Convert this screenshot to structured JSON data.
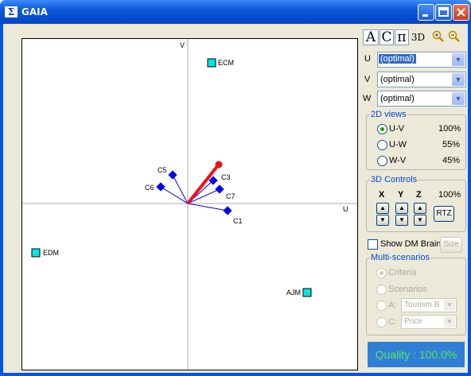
{
  "window": {
    "title": "GAIA",
    "app_icon": "sigma-icon"
  },
  "plot": {
    "axis_v_label": "V",
    "axis_u_label": "U",
    "alternatives": [
      {
        "label": "ECM"
      },
      {
        "label": "EDM"
      },
      {
        "label": "AJM"
      }
    ],
    "criteria": [
      {
        "label": "C5"
      },
      {
        "label": "C6"
      },
      {
        "label": "C3"
      },
      {
        "label": "C7"
      },
      {
        "label": "C1"
      }
    ],
    "colors": {
      "criteria": "#0000ee",
      "alternatives": "#00e5e5",
      "decision_stick": "#ee1111"
    }
  },
  "toolbar": {
    "a_label": "A",
    "c_label": "C",
    "pi_label": "π",
    "3d_label": "3D"
  },
  "axes": [
    {
      "label": "U",
      "value": "(optimal)",
      "selected": true
    },
    {
      "label": "V",
      "value": "(optimal)"
    },
    {
      "label": "W",
      "value": "(optimal)"
    }
  ],
  "views_2d": {
    "legend": "2D views",
    "options": [
      {
        "label": "U-V",
        "pct": "100%",
        "checked": true
      },
      {
        "label": "U-W",
        "pct": "55%"
      },
      {
        "label": "W-V",
        "pct": "45%"
      }
    ]
  },
  "controls_3d": {
    "legend": "3D Controls",
    "x": "X",
    "y": "Y",
    "z": "Z",
    "pct": "100%",
    "rtz": "RTZ"
  },
  "dm_brain": {
    "label": "Show DM Brain",
    "size": "Size"
  },
  "multi": {
    "legend": "Multi-scenarios",
    "criteria": "Criteria",
    "scenarios": "Scenarios",
    "a_label": "A:",
    "a_value": "Tourism B",
    "c_label": "C:",
    "c_value": "Price"
  },
  "quality": "Quality : 100.0%"
}
